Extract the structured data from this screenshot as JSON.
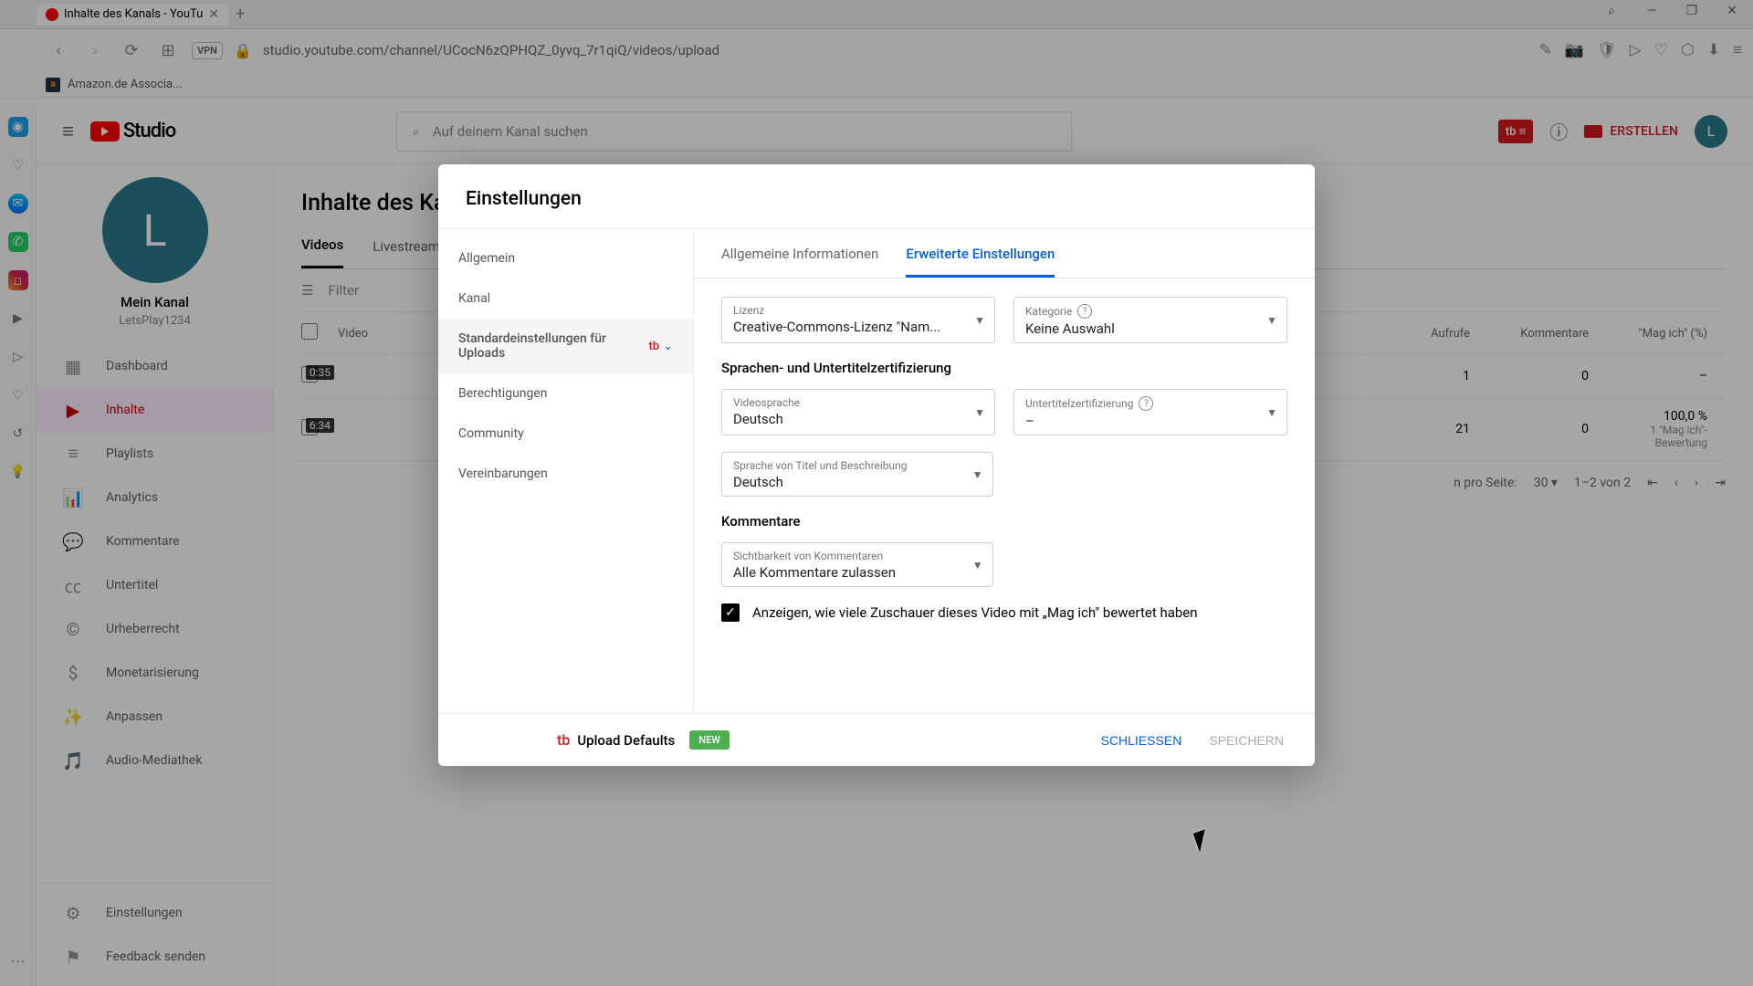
{
  "browser": {
    "tab_title": "Inhalte des Kanals - YouTu",
    "url": "studio.youtube.com/channel/UCocN6zQPHQZ_0yvq_7r1qiQ/videos/upload",
    "vpn": "VPN",
    "bookmark": "Amazon.de Associa..."
  },
  "studio": {
    "logo": "Studio",
    "search_placeholder": "Auf deinem Kanal suchen",
    "create": "ERSTELLEN",
    "avatar": "L",
    "channel_name": "Mein Kanal",
    "channel_handle": "LetsPlay1234",
    "side": {
      "dashboard": "Dashboard",
      "inhalte": "Inhalte",
      "playlists": "Playlists",
      "analytics": "Analytics",
      "kommentare": "Kommentare",
      "untertitel": "Untertitel",
      "urheber": "Urheberrecht",
      "monet": "Monetarisierung",
      "anpassen": "Anpassen",
      "audio": "Audio-Mediathek",
      "einstell": "Einstellungen",
      "feedback": "Feedback senden"
    },
    "page_title": "Inhalte des Kanals",
    "tabs": {
      "videos": "Videos",
      "live": "Livestreams"
    },
    "filter": "Filter",
    "cols": {
      "video": "Video",
      "aufrufe": "Aufrufe",
      "kommentare": "Kommentare",
      "magich": "\"Mag ich\" (%)"
    },
    "rows": [
      {
        "dur": "0:35",
        "aufrufe": "1",
        "kommentare": "0",
        "magich": "–"
      },
      {
        "dur": "6:34",
        "aufrufe": "21",
        "kommentare": "0",
        "magich": "100,0 %",
        "magich_sub": "1 \"Mag ich\"-Bewertung"
      }
    ],
    "pager": {
      "label": "n pro Seite:",
      "size": "30",
      "range": "1–2 von 2"
    }
  },
  "modal": {
    "title": "Einstellungen",
    "side": {
      "allgemein": "Allgemein",
      "kanal": "Kanal",
      "upload": "Standardeinstellungen für Uploads",
      "berecht": "Berechtigungen",
      "community": "Community",
      "verein": "Vereinbarungen"
    },
    "tabs": {
      "general": "Allgemeine Informationen",
      "advanced": "Erweiterte Einstellungen"
    },
    "license": {
      "label": "Lizenz",
      "value": "Creative-Commons-Lizenz \"Nam..."
    },
    "category": {
      "label": "Kategorie",
      "value": "Keine Auswahl"
    },
    "lang_section": "Sprachen- und Untertitelzertifizierung",
    "videolang": {
      "label": "Videosprache",
      "value": "Deutsch"
    },
    "cert": {
      "label": "Untertitelzertifizierung",
      "value": "–"
    },
    "titlelang": {
      "label": "Sprache von Titel und Beschreibung",
      "value": "Deutsch"
    },
    "comments_section": "Kommentare",
    "comments": {
      "label": "Sichtbarkeit von Kommentaren",
      "value": "Alle Kommentare zulassen"
    },
    "likes_check": "Anzeigen, wie viele Zuschauer dieses Video mit „Mag ich\" bewertet haben",
    "footer": {
      "upload_defaults": "Upload Defaults",
      "new": "NEW",
      "close": "SCHLIESSEN",
      "save": "SPEICHERN"
    }
  }
}
